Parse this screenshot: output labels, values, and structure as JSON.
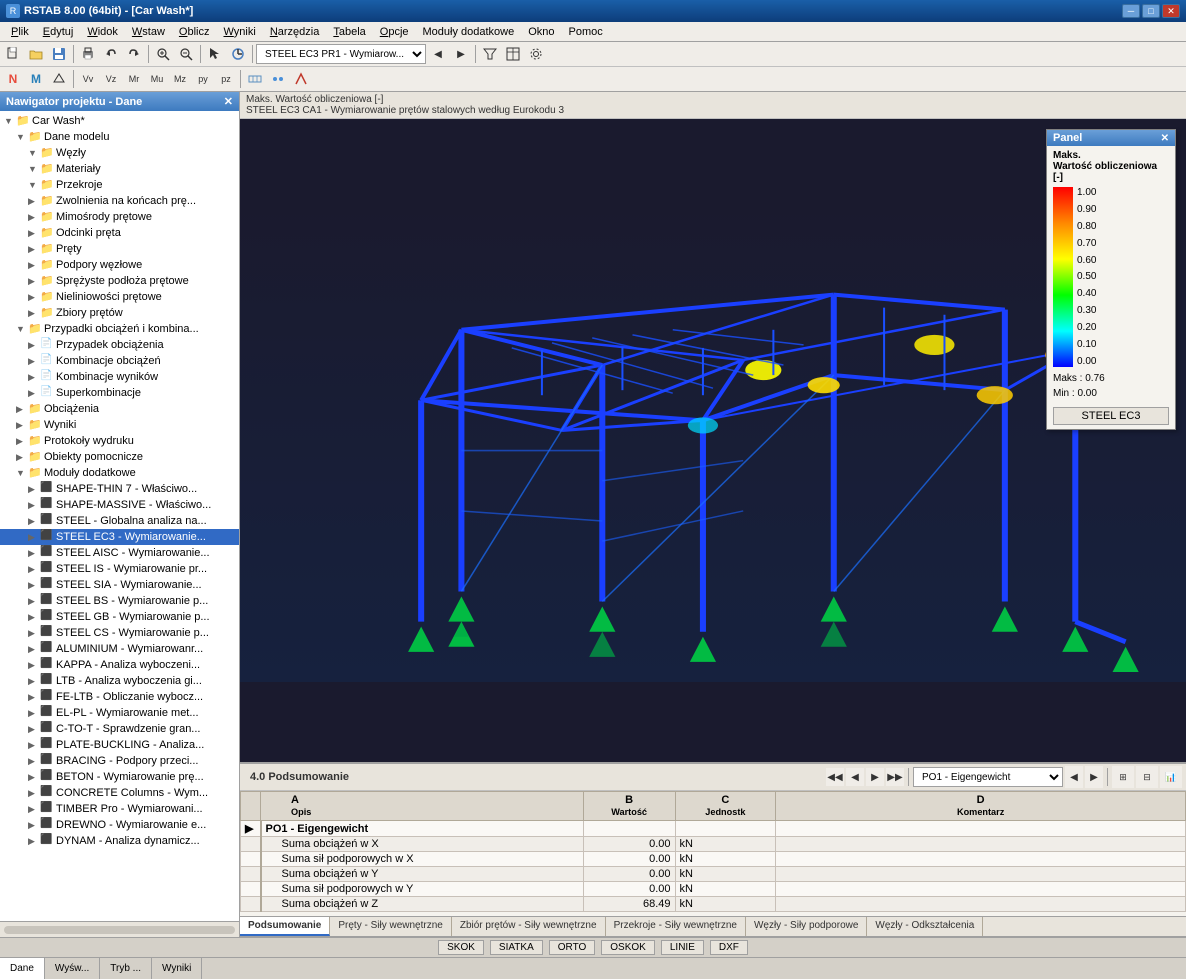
{
  "titleBar": {
    "title": "RSTAB 8.00 (64bit) - [Car Wash*]",
    "icon": "R",
    "controls": [
      "minimize",
      "maximize",
      "close"
    ]
  },
  "menuBar": {
    "items": [
      "Plik",
      "Edytuj",
      "Widok",
      "Wstaw",
      "Oblicz",
      "Wyniki",
      "Narzędzia",
      "Tabela",
      "Opcje",
      "Moduły dodatkowe",
      "Okno",
      "Pomoc"
    ]
  },
  "toolbar1": {
    "dropdown": "STEEL EC3 PR1 - Wymiarow..."
  },
  "viewport": {
    "header1": "Maks. Wartość obliczeniowa [-]",
    "header2": "STEEL EC3 CA1 - Wymiarowanie prętów stalowych według Eurokodu 3"
  },
  "legend": {
    "title": "Panel",
    "subtitle": "Maks.\nWartość obliczeniowa [-]",
    "scaleLabels": [
      "1.00",
      "0.90",
      "0.80",
      "0.70",
      "0.60",
      "0.50",
      "0.40",
      "0.30",
      "0.20",
      "0.10",
      "0.00"
    ],
    "maxValue": "Maks : 0.76",
    "minValue": "Min :  0.00",
    "button": "STEEL EC3"
  },
  "bottomPanel": {
    "title": "4.0 Podsumowanie",
    "dropdown": "PO1 - Eigengewicht",
    "table": {
      "columns": [
        "A\nOpis",
        "B\nWartość",
        "C\nJednostk",
        "D\nKomentarz"
      ],
      "rows": [
        {
          "type": "group",
          "desc": "PO1 - Eigengewicht",
          "value": "",
          "unit": "",
          "comment": ""
        },
        {
          "type": "data",
          "desc": "Suma obciążeń w X",
          "value": "0.00",
          "unit": "kN",
          "comment": ""
        },
        {
          "type": "data",
          "desc": "Suma sił podporowych w X",
          "value": "0.00",
          "unit": "kN",
          "comment": ""
        },
        {
          "type": "data",
          "desc": "Suma obciążeń w Y",
          "value": "0.00",
          "unit": "kN",
          "comment": ""
        },
        {
          "type": "data",
          "desc": "Suma sił podporowych w Y",
          "value": "0.00",
          "unit": "kN",
          "comment": ""
        },
        {
          "type": "data",
          "desc": "Suma obciążeń w Z",
          "value": "68.49",
          "unit": "kN",
          "comment": ""
        }
      ]
    }
  },
  "tabs": [
    "Podsumowanie",
    "Pręty - Siły wewnętrzne",
    "Zbiór prętów - Siły wewnętrzne",
    "Przekroje - Siły wewnętrzne",
    "Węzły - Siły podporowe",
    "Węzły - Odkształcenia"
  ],
  "activeTab": "Podsumowanie",
  "statusBar": {
    "buttons": [
      "SKOK",
      "SIATKA",
      "ORTO",
      "OSKOK",
      "LINIE",
      "DXF"
    ]
  },
  "bottomNav": {
    "tabs": [
      "Dane",
      "Wyśw...",
      "Tryb ...",
      "Wyniki"
    ],
    "active": "Dane"
  },
  "navigator": {
    "title": "Nawigator projektu - Dane",
    "tree": [
      {
        "level": 0,
        "expanded": true,
        "icon": "folder",
        "label": "Car Wash*"
      },
      {
        "level": 1,
        "expanded": true,
        "icon": "folder",
        "label": "Dane modelu"
      },
      {
        "level": 2,
        "expanded": true,
        "icon": "folder",
        "label": "Węzły"
      },
      {
        "level": 2,
        "expanded": true,
        "icon": "folder",
        "label": "Materiały"
      },
      {
        "level": 2,
        "expanded": true,
        "icon": "folder",
        "label": "Przekroje"
      },
      {
        "level": 2,
        "expanded": false,
        "icon": "folder",
        "label": "Zwolnienia na końcach prę..."
      },
      {
        "level": 2,
        "expanded": false,
        "icon": "folder",
        "label": "Mimośrody prętowe"
      },
      {
        "level": 2,
        "expanded": false,
        "icon": "folder",
        "label": "Odcinki pręta"
      },
      {
        "level": 2,
        "expanded": false,
        "icon": "folder",
        "label": "Pręty"
      },
      {
        "level": 2,
        "expanded": false,
        "icon": "folder",
        "label": "Podpory węzłowe"
      },
      {
        "level": 2,
        "expanded": false,
        "icon": "folder",
        "label": "Sprężyste podłoża prętowe"
      },
      {
        "level": 2,
        "expanded": false,
        "icon": "folder",
        "label": "Nieliniowości prętowe"
      },
      {
        "level": 2,
        "expanded": false,
        "icon": "folder",
        "label": "Zbiory prętów"
      },
      {
        "level": 1,
        "expanded": true,
        "icon": "folder",
        "label": "Przypadki obciążeń i kombina..."
      },
      {
        "level": 2,
        "expanded": false,
        "icon": "item",
        "label": "Przypadek obciążenia"
      },
      {
        "level": 2,
        "expanded": false,
        "icon": "item",
        "label": "Kombinacje obciążeń"
      },
      {
        "level": 2,
        "expanded": false,
        "icon": "item",
        "label": "Kombinacje wyników"
      },
      {
        "level": 2,
        "expanded": false,
        "icon": "item",
        "label": "Superkombinacje"
      },
      {
        "level": 1,
        "expanded": false,
        "icon": "folder",
        "label": "Obciążenia"
      },
      {
        "level": 1,
        "expanded": false,
        "icon": "folder",
        "label": "Wyniki"
      },
      {
        "level": 1,
        "expanded": false,
        "icon": "folder",
        "label": "Protokoły wydruku"
      },
      {
        "level": 1,
        "expanded": false,
        "icon": "folder",
        "label": "Obiekty pomocnicze"
      },
      {
        "level": 1,
        "expanded": true,
        "icon": "folder",
        "label": "Moduły dodatkowe"
      },
      {
        "level": 2,
        "expanded": false,
        "icon": "module",
        "label": "SHAPE-THIN 7 - Właściwo..."
      },
      {
        "level": 2,
        "expanded": false,
        "icon": "module",
        "label": "SHAPE-MASSIVE - Właściwo..."
      },
      {
        "level": 2,
        "expanded": false,
        "icon": "module",
        "label": "STEEL - Globalna analiza na..."
      },
      {
        "level": 2,
        "expanded": false,
        "icon": "module",
        "selected": true,
        "label": "STEEL EC3 - Wymiarowanie..."
      },
      {
        "level": 2,
        "expanded": false,
        "icon": "module",
        "label": "STEEL AISC - Wymiarowanie..."
      },
      {
        "level": 2,
        "expanded": false,
        "icon": "module",
        "label": "STEEL IS - Wymiarowanie pr..."
      },
      {
        "level": 2,
        "expanded": false,
        "icon": "module",
        "label": "STEEL SIA - Wymiarowanie..."
      },
      {
        "level": 2,
        "expanded": false,
        "icon": "module",
        "label": "STEEL BS - Wymiarowanie p..."
      },
      {
        "level": 2,
        "expanded": false,
        "icon": "module",
        "label": "STEEL GB - Wymiarowanie p..."
      },
      {
        "level": 2,
        "expanded": false,
        "icon": "module",
        "label": "STEEL CS - Wymiarowanie p..."
      },
      {
        "level": 2,
        "expanded": false,
        "icon": "module",
        "label": "ALUMINIUM - Wymiarowanr..."
      },
      {
        "level": 2,
        "expanded": false,
        "icon": "module",
        "label": "KAPPA - Analiza wyboczeni..."
      },
      {
        "level": 2,
        "expanded": false,
        "icon": "module",
        "label": "LTB - Analiza wyboczenia gi..."
      },
      {
        "level": 2,
        "expanded": false,
        "icon": "module",
        "label": "FE-LTB - Obliczanie wybocz..."
      },
      {
        "level": 2,
        "expanded": false,
        "icon": "module",
        "label": "EL-PL - Wymiarowanie met..."
      },
      {
        "level": 2,
        "expanded": false,
        "icon": "module",
        "label": "C-TO-T - Sprawdzenie gran..."
      },
      {
        "level": 2,
        "expanded": false,
        "icon": "module",
        "label": "PLATE-BUCKLING - Analiza..."
      },
      {
        "level": 2,
        "expanded": false,
        "icon": "module",
        "label": "BRACING - Podpory przeci..."
      },
      {
        "level": 2,
        "expanded": false,
        "icon": "module",
        "label": "BETON - Wymiarowanie prę..."
      },
      {
        "level": 2,
        "expanded": false,
        "icon": "module",
        "label": "CONCRETE Columns - Wym..."
      },
      {
        "level": 2,
        "expanded": false,
        "icon": "module",
        "label": "TIMBER Pro - Wymiarowani..."
      },
      {
        "level": 2,
        "expanded": false,
        "icon": "module",
        "label": "DREWNO - Wymiarowanie e..."
      },
      {
        "level": 2,
        "expanded": false,
        "icon": "module",
        "label": "DYNAM - Analiza dynamicz..."
      }
    ]
  }
}
